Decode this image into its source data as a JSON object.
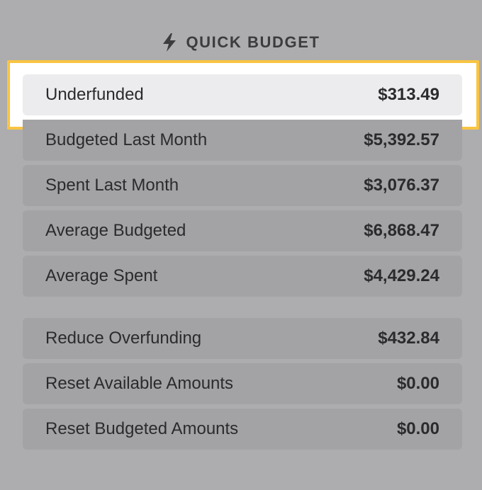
{
  "header": {
    "icon": "lightning-bolt-icon",
    "title": "QUICK BUDGET"
  },
  "rows": [
    {
      "label": "Underfunded",
      "amount": "$313.49",
      "selected": true
    },
    {
      "label": "Budgeted Last Month",
      "amount": "$5,392.57"
    },
    {
      "label": "Spent Last Month",
      "amount": "$3,076.37"
    },
    {
      "label": "Average Budgeted",
      "amount": "$6,868.47"
    },
    {
      "label": "Average Spent",
      "amount": "$4,429.24"
    },
    {
      "label": "Reduce Overfunding",
      "amount": "$432.84"
    },
    {
      "label": "Reset Available Amounts",
      "amount": "$0.00"
    },
    {
      "label": "Reset Budgeted Amounts",
      "amount": "$0.00"
    }
  ],
  "colors": {
    "highlight_border": "#f9c443",
    "panel_bg": "#adadaf",
    "row_bg": "#a3a3a5",
    "selected_row_bg": "#ececee",
    "text": "#2b2b2d"
  }
}
